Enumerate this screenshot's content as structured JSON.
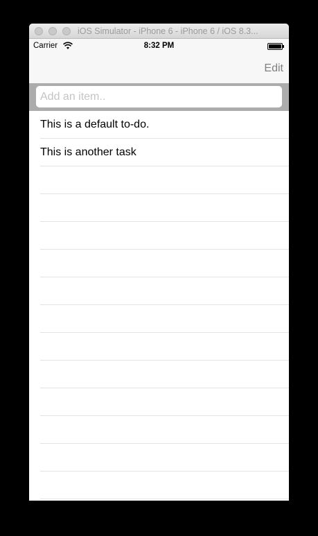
{
  "window": {
    "title": "iOS Simulator - iPhone 6 - iPhone 6 / iOS 8.3..."
  },
  "status": {
    "carrier": "Carrier",
    "time": "8:32 PM"
  },
  "nav": {
    "edit_label": "Edit"
  },
  "input": {
    "placeholder": "Add an item..",
    "value": ""
  },
  "todos": [
    {
      "label": "This is a default to-do."
    },
    {
      "label": "This is another task"
    },
    {
      "label": ""
    },
    {
      "label": ""
    },
    {
      "label": ""
    },
    {
      "label": ""
    },
    {
      "label": ""
    },
    {
      "label": ""
    },
    {
      "label": ""
    },
    {
      "label": ""
    },
    {
      "label": ""
    },
    {
      "label": ""
    },
    {
      "label": ""
    },
    {
      "label": ""
    }
  ],
  "colors": {
    "edit": "#7f7f7f",
    "searchbar": "#acacac",
    "separator": "#e3e3e3"
  },
  "icons": [
    "wifi-icon",
    "battery-icon"
  ]
}
